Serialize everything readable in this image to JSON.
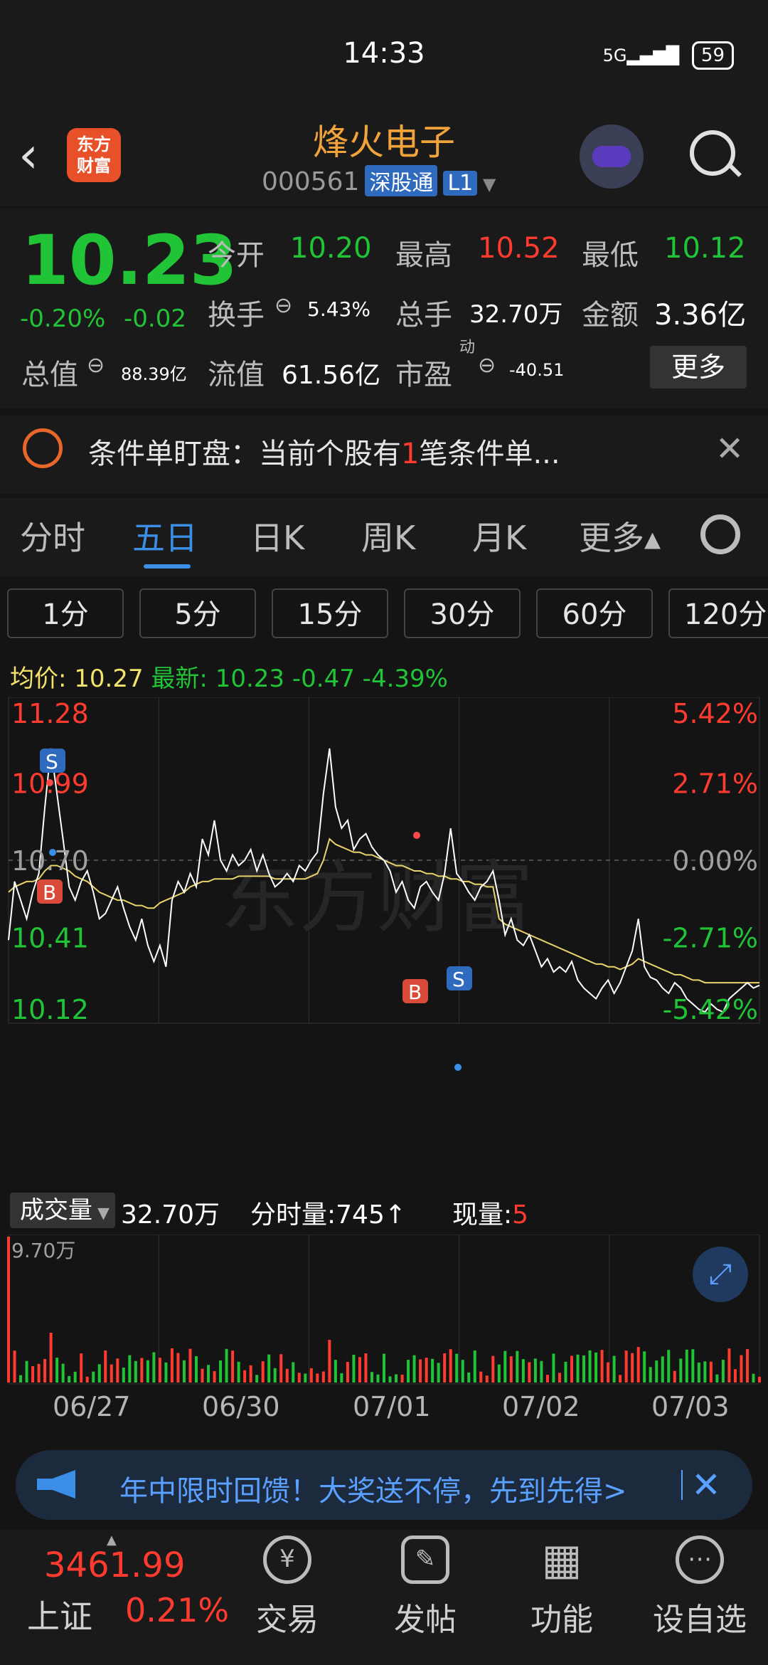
{
  "status_bar": {
    "time": "14:33",
    "signal": "5G",
    "battery": "59"
  },
  "header": {
    "back_glyph": "‹",
    "logo_line1": "东方",
    "logo_line2": "财富",
    "name": "烽火电子",
    "code": "000561",
    "tag1": "深股通",
    "tag2": "L1"
  },
  "quote": {
    "price": "10.23",
    "change_pct": "-0.20%",
    "change": "-0.02",
    "open_label": "今开",
    "open": "10.20",
    "high_label": "最高",
    "high": "10.52",
    "low_label": "最低",
    "low": "10.12",
    "turnover_label": "换手",
    "turnover": "5.43%",
    "volume_label": "总手",
    "volume": "32.70万",
    "amount_label": "金额",
    "amount": "3.36亿",
    "mktcap_label": "总值",
    "mktcap": "88.39亿",
    "float_label": "流值",
    "float": "61.56亿",
    "pe_label": "市盈",
    "pe_sup": "动",
    "pe": "-40.51",
    "more": "更多"
  },
  "alert": {
    "text_a": "条件单盯盘：当前个股有",
    "count": "1",
    "text_b": "笔条件单..."
  },
  "tabs": [
    {
      "label": "分时"
    },
    {
      "label": "五日"
    },
    {
      "label": "日K"
    },
    {
      "label": "周K"
    },
    {
      "label": "月K"
    },
    {
      "label": "更多▴"
    }
  ],
  "periods": [
    "1分",
    "5分",
    "15分",
    "30分",
    "60分",
    "120分"
  ],
  "avg": {
    "avg_label": "均价:",
    "avg": "10.27",
    "latest_label": "最新:",
    "latest": "10.23",
    "chg": "-0.47",
    "pct": "-4.39%"
  },
  "chart_data": {
    "type": "line",
    "title": "",
    "x_labels": [
      "06/27",
      "06/30",
      "07/01",
      "07/02",
      "07/03"
    ],
    "ylim": [
      10.12,
      11.28
    ],
    "y_ticks_left": [
      "11.28",
      "10.99",
      "10.70",
      "10.41",
      "10.12"
    ],
    "y_ticks_right": [
      "5.42%",
      "2.71%",
      "0.00%",
      "-2.71%",
      "-5.42%"
    ],
    "reference": 10.7,
    "series": [
      {
        "values": [
          10.4,
          10.62,
          10.55,
          10.48,
          10.58,
          10.65,
          10.9,
          11.12,
          10.95,
          10.78,
          10.6,
          10.55,
          10.62,
          10.66,
          10.58,
          10.48,
          10.5,
          10.55,
          10.6,
          10.52,
          10.45,
          10.4,
          10.48,
          10.38,
          10.32,
          10.38,
          10.3,
          10.55,
          10.62,
          10.58,
          10.65,
          10.6,
          10.78,
          10.72,
          10.85,
          10.7,
          10.66,
          10.72,
          10.68,
          10.7,
          10.74,
          10.66,
          10.72,
          10.65,
          10.6,
          10.62,
          10.65,
          10.62,
          10.68,
          10.66,
          10.7,
          10.73,
          10.95,
          11.12,
          10.9,
          10.82,
          10.85,
          10.74,
          10.78,
          10.8,
          10.75,
          10.72,
          10.7,
          10.66,
          10.58,
          10.62,
          10.55,
          10.52,
          10.6,
          10.62,
          10.58,
          10.55,
          10.65,
          10.82,
          10.65,
          10.62,
          10.58,
          10.55,
          10.6,
          10.62,
          10.66,
          10.55,
          10.42,
          10.48,
          10.4,
          10.38,
          10.42,
          10.36,
          10.3,
          10.33,
          10.28,
          10.3,
          10.28,
          10.32,
          10.25,
          10.22,
          10.2,
          10.18,
          10.22,
          10.25,
          10.2,
          10.24,
          10.3,
          10.36,
          10.48,
          10.3,
          10.26,
          10.25,
          10.22,
          10.2,
          10.24,
          10.22,
          10.18,
          10.16,
          10.14,
          10.13,
          10.16,
          10.14,
          10.13,
          10.18,
          10.2,
          10.22,
          10.24,
          10.22,
          10.23
        ]
      },
      {
        "values": [
          10.58,
          10.6,
          10.61,
          10.62,
          10.62,
          10.63,
          10.66,
          10.68,
          10.68,
          10.67,
          10.66,
          10.64,
          10.63,
          10.62,
          10.6,
          10.58,
          10.57,
          10.56,
          10.55,
          10.55,
          10.54,
          10.53,
          10.53,
          10.52,
          10.52,
          10.54,
          10.55,
          10.56,
          10.57,
          10.58,
          10.6,
          10.61,
          10.62,
          10.62,
          10.63,
          10.63,
          10.63,
          10.63,
          10.64,
          10.64,
          10.64,
          10.64,
          10.64,
          10.64,
          10.63,
          10.63,
          10.63,
          10.63,
          10.63,
          10.63,
          10.64,
          10.65,
          10.7,
          10.78,
          10.76,
          10.75,
          10.74,
          10.73,
          10.73,
          10.72,
          10.72,
          10.71,
          10.7,
          10.69,
          10.68,
          10.68,
          10.67,
          10.66,
          10.66,
          10.65,
          10.65,
          10.64,
          10.64,
          10.63,
          10.63,
          10.62,
          10.62,
          10.61,
          10.61,
          10.6,
          10.6,
          10.48,
          10.46,
          10.45,
          10.44,
          10.43,
          10.42,
          10.41,
          10.4,
          10.39,
          10.38,
          10.37,
          10.36,
          10.35,
          10.34,
          10.33,
          10.32,
          10.31,
          10.31,
          10.3,
          10.3,
          10.29,
          10.3,
          10.31,
          10.33,
          10.32,
          10.31,
          10.3,
          10.29,
          10.28,
          10.27,
          10.27,
          10.26,
          10.25,
          10.25,
          10.24,
          10.24,
          10.24,
          10.24,
          10.24,
          10.24,
          10.24,
          10.24,
          10.24,
          10.24
        ]
      }
    ],
    "volume_max_label": "9.70万"
  },
  "volume": {
    "label": "成交量",
    "total": "32.70万",
    "minute_label": "分时量:745↑",
    "now_label": "现量:",
    "now": "5"
  },
  "ad": {
    "text": "年中限时回馈！大奖送不停，先到先得>",
    "close": "✕"
  },
  "bottom": {
    "index_value": "3461.99",
    "index_name": "上证",
    "index_pct": "0.21%",
    "nav": [
      {
        "label": "交易",
        "icon": "¥"
      },
      {
        "label": "发帖",
        "icon": "✎"
      },
      {
        "label": "功能",
        "icon": "▦"
      },
      {
        "label": "设自选",
        "icon": "⋯"
      }
    ]
  }
}
